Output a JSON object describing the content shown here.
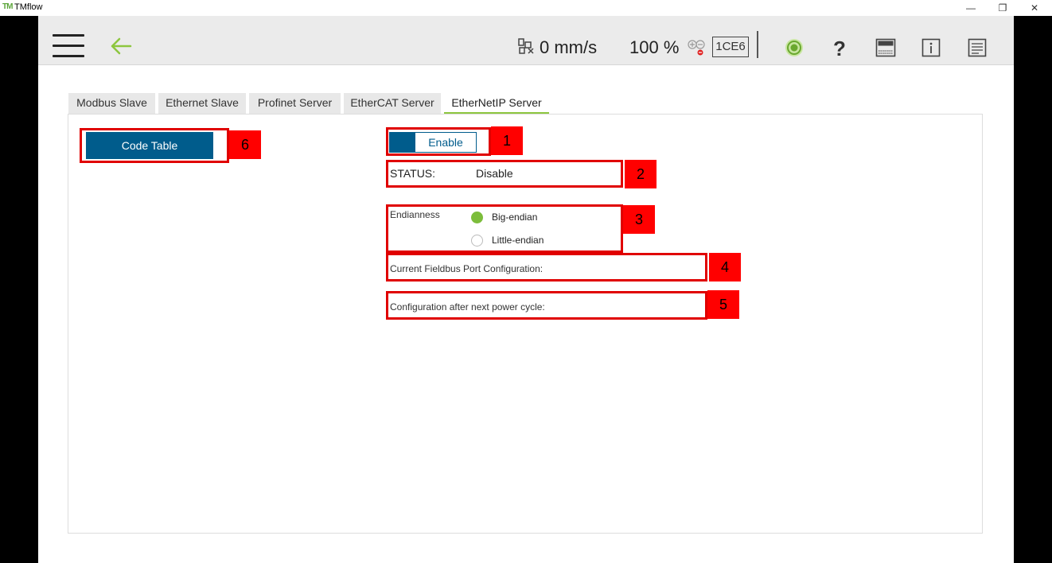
{
  "window": {
    "logo": "TM",
    "title": "TMflow",
    "minimize_glyph": "—",
    "maximize_glyph": "❐",
    "close_glyph": "✕"
  },
  "header": {
    "speed": "0 mm/s",
    "percent": "100 %",
    "code": "1CE6",
    "icons": [
      "menu-icon",
      "back-arrow-icon",
      "robot-speed-icon",
      "plus-minus-icon",
      "status-indicator-icon",
      "help-icon",
      "display-icon",
      "info-icon",
      "log-icon"
    ]
  },
  "tabs": [
    {
      "label": "Modbus Slave"
    },
    {
      "label": "Ethernet Slave"
    },
    {
      "label": "Profinet Server"
    },
    {
      "label": "EtherCAT Server"
    },
    {
      "label": "EtherNetIP Server"
    }
  ],
  "active_tab": "EtherNetIP Server",
  "content": {
    "code_table_label": "Code Table",
    "enable_label": "Enable",
    "status_label": "STATUS:",
    "status_value": "Disable",
    "endianness_label": "Endianness",
    "endian_options": [
      {
        "label": "Big-endian",
        "selected": true
      },
      {
        "label": "Little-endian",
        "selected": false
      }
    ],
    "current_config_label": "Current Fieldbus Port Configuration:",
    "next_config_label": "Configuration after next power cycle:"
  },
  "annotations": [
    "1",
    "2",
    "3",
    "4",
    "5",
    "6"
  ],
  "colors": {
    "accent_blue": "#005c8c",
    "accent_green": "#8dc63f",
    "callout_red": "#ff0000"
  }
}
